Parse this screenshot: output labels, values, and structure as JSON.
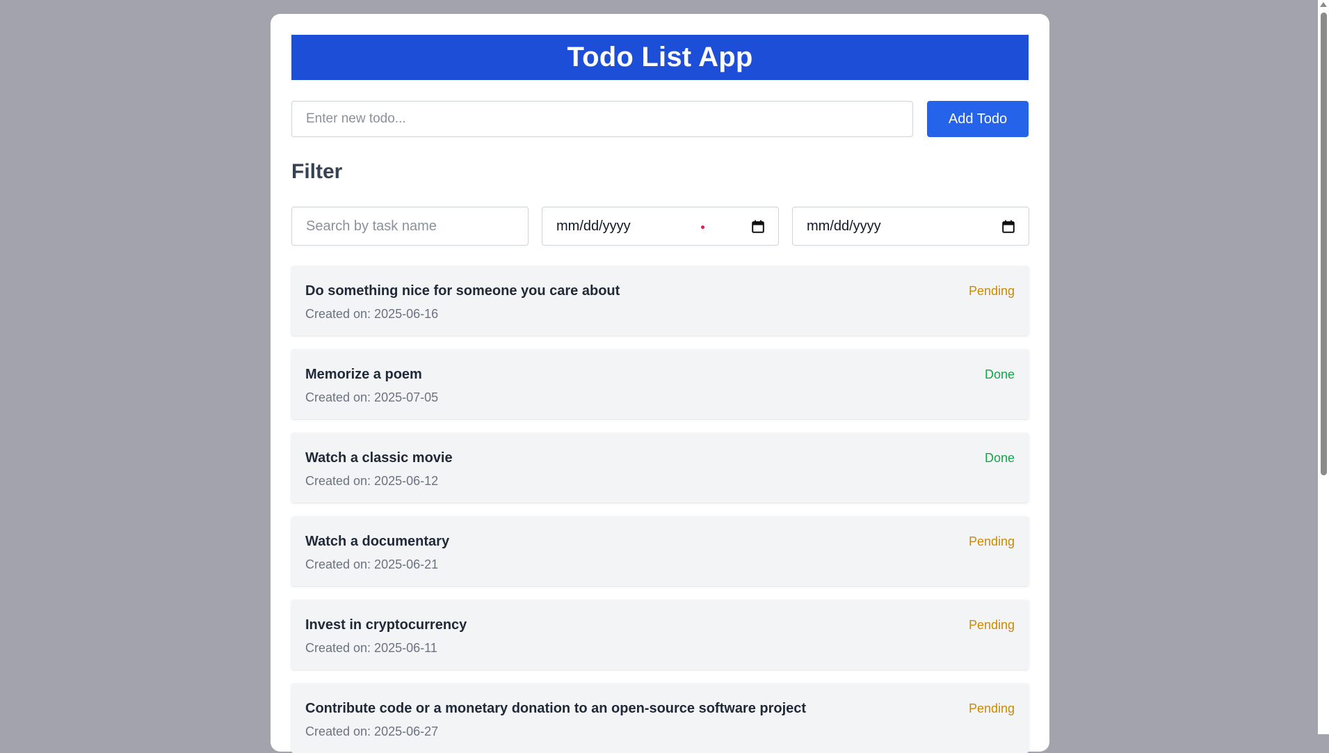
{
  "header": {
    "title": "Todo List App"
  },
  "new_todo": {
    "placeholder": "Enter new todo...",
    "value": "",
    "add_label": "Add Todo"
  },
  "filter": {
    "title": "Filter",
    "search_placeholder": "Search by task name",
    "start_date": "mm/dd/yyyy",
    "end_date": "mm/dd/yyyy"
  },
  "todos": [
    {
      "title": "Do something nice for someone you care about",
      "created": "Created on: 2025-06-16",
      "status": "Pending"
    },
    {
      "title": "Memorize a poem",
      "created": "Created on: 2025-07-05",
      "status": "Done"
    },
    {
      "title": "Watch a classic movie",
      "created": "Created on: 2025-06-12",
      "status": "Done"
    },
    {
      "title": "Watch a documentary",
      "created": "Created on: 2025-06-21",
      "status": "Pending"
    },
    {
      "title": "Invest in cryptocurrency",
      "created": "Created on: 2025-06-11",
      "status": "Pending"
    },
    {
      "title": "Contribute code or a monetary donation to an open-source software project",
      "created": "Created on: 2025-06-27",
      "status": "Pending"
    }
  ],
  "colors": {
    "header_bg": "#1d4ed8",
    "button_bg": "#2563eb",
    "pending": "#ca8a04",
    "done": "#16a34a",
    "page_bg": "#a2a3ad"
  }
}
